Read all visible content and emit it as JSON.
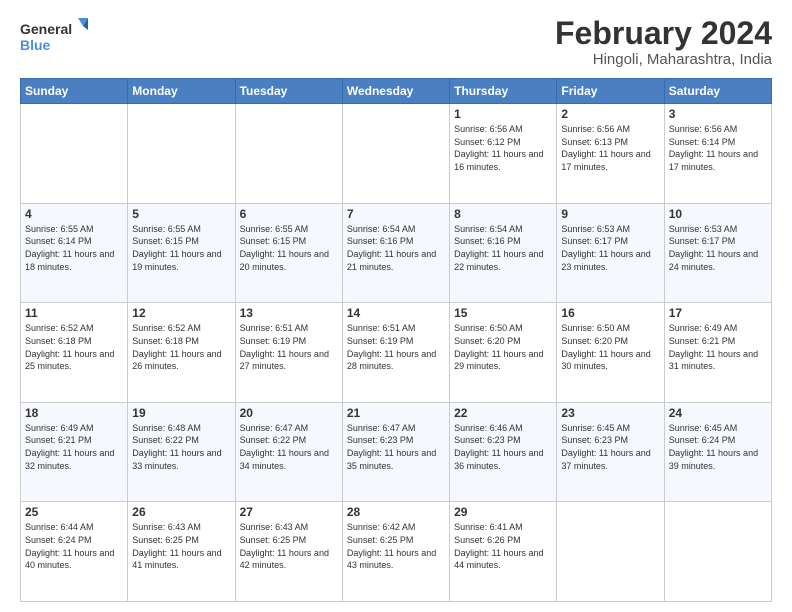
{
  "logo": {
    "line1": "General",
    "line2": "Blue"
  },
  "title": "February 2024",
  "subtitle": "Hingoli, Maharashtra, India",
  "weekdays": [
    "Sunday",
    "Monday",
    "Tuesday",
    "Wednesday",
    "Thursday",
    "Friday",
    "Saturday"
  ],
  "weeks": [
    [
      {
        "day": "",
        "info": ""
      },
      {
        "day": "",
        "info": ""
      },
      {
        "day": "",
        "info": ""
      },
      {
        "day": "",
        "info": ""
      },
      {
        "day": "1",
        "info": "Sunrise: 6:56 AM\nSunset: 6:12 PM\nDaylight: 11 hours and 16 minutes."
      },
      {
        "day": "2",
        "info": "Sunrise: 6:56 AM\nSunset: 6:13 PM\nDaylight: 11 hours and 17 minutes."
      },
      {
        "day": "3",
        "info": "Sunrise: 6:56 AM\nSunset: 6:14 PM\nDaylight: 11 hours and 17 minutes."
      }
    ],
    [
      {
        "day": "4",
        "info": "Sunrise: 6:55 AM\nSunset: 6:14 PM\nDaylight: 11 hours and 18 minutes."
      },
      {
        "day": "5",
        "info": "Sunrise: 6:55 AM\nSunset: 6:15 PM\nDaylight: 11 hours and 19 minutes."
      },
      {
        "day": "6",
        "info": "Sunrise: 6:55 AM\nSunset: 6:15 PM\nDaylight: 11 hours and 20 minutes."
      },
      {
        "day": "7",
        "info": "Sunrise: 6:54 AM\nSunset: 6:16 PM\nDaylight: 11 hours and 21 minutes."
      },
      {
        "day": "8",
        "info": "Sunrise: 6:54 AM\nSunset: 6:16 PM\nDaylight: 11 hours and 22 minutes."
      },
      {
        "day": "9",
        "info": "Sunrise: 6:53 AM\nSunset: 6:17 PM\nDaylight: 11 hours and 23 minutes."
      },
      {
        "day": "10",
        "info": "Sunrise: 6:53 AM\nSunset: 6:17 PM\nDaylight: 11 hours and 24 minutes."
      }
    ],
    [
      {
        "day": "11",
        "info": "Sunrise: 6:52 AM\nSunset: 6:18 PM\nDaylight: 11 hours and 25 minutes."
      },
      {
        "day": "12",
        "info": "Sunrise: 6:52 AM\nSunset: 6:18 PM\nDaylight: 11 hours and 26 minutes."
      },
      {
        "day": "13",
        "info": "Sunrise: 6:51 AM\nSunset: 6:19 PM\nDaylight: 11 hours and 27 minutes."
      },
      {
        "day": "14",
        "info": "Sunrise: 6:51 AM\nSunset: 6:19 PM\nDaylight: 11 hours and 28 minutes."
      },
      {
        "day": "15",
        "info": "Sunrise: 6:50 AM\nSunset: 6:20 PM\nDaylight: 11 hours and 29 minutes."
      },
      {
        "day": "16",
        "info": "Sunrise: 6:50 AM\nSunset: 6:20 PM\nDaylight: 11 hours and 30 minutes."
      },
      {
        "day": "17",
        "info": "Sunrise: 6:49 AM\nSunset: 6:21 PM\nDaylight: 11 hours and 31 minutes."
      }
    ],
    [
      {
        "day": "18",
        "info": "Sunrise: 6:49 AM\nSunset: 6:21 PM\nDaylight: 11 hours and 32 minutes."
      },
      {
        "day": "19",
        "info": "Sunrise: 6:48 AM\nSunset: 6:22 PM\nDaylight: 11 hours and 33 minutes."
      },
      {
        "day": "20",
        "info": "Sunrise: 6:47 AM\nSunset: 6:22 PM\nDaylight: 11 hours and 34 minutes."
      },
      {
        "day": "21",
        "info": "Sunrise: 6:47 AM\nSunset: 6:23 PM\nDaylight: 11 hours and 35 minutes."
      },
      {
        "day": "22",
        "info": "Sunrise: 6:46 AM\nSunset: 6:23 PM\nDaylight: 11 hours and 36 minutes."
      },
      {
        "day": "23",
        "info": "Sunrise: 6:45 AM\nSunset: 6:23 PM\nDaylight: 11 hours and 37 minutes."
      },
      {
        "day": "24",
        "info": "Sunrise: 6:45 AM\nSunset: 6:24 PM\nDaylight: 11 hours and 39 minutes."
      }
    ],
    [
      {
        "day": "25",
        "info": "Sunrise: 6:44 AM\nSunset: 6:24 PM\nDaylight: 11 hours and 40 minutes."
      },
      {
        "day": "26",
        "info": "Sunrise: 6:43 AM\nSunset: 6:25 PM\nDaylight: 11 hours and 41 minutes."
      },
      {
        "day": "27",
        "info": "Sunrise: 6:43 AM\nSunset: 6:25 PM\nDaylight: 11 hours and 42 minutes."
      },
      {
        "day": "28",
        "info": "Sunrise: 6:42 AM\nSunset: 6:25 PM\nDaylight: 11 hours and 43 minutes."
      },
      {
        "day": "29",
        "info": "Sunrise: 6:41 AM\nSunset: 6:26 PM\nDaylight: 11 hours and 44 minutes."
      },
      {
        "day": "",
        "info": ""
      },
      {
        "day": "",
        "info": ""
      }
    ]
  ]
}
